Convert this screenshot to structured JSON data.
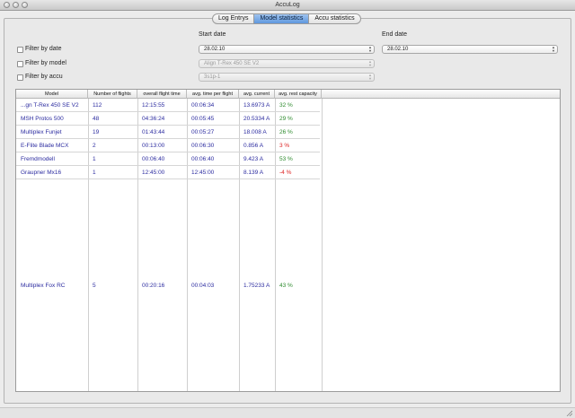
{
  "window": {
    "title": "AccuLog"
  },
  "tabs": [
    {
      "label": "Log Entrys"
    },
    {
      "label": "Model statistics"
    },
    {
      "label": "Accu statistics"
    }
  ],
  "filters": {
    "start_date_label": "Start date",
    "end_date_label": "End date",
    "by_date_label": "Filter by date",
    "by_model_label": "Filter by model",
    "by_accu_label": "Filter by accu",
    "start_date_value": "28.02.10",
    "end_date_value": "28.02.10",
    "model_value": "Align T-Rex 450 SE V2",
    "accu_value": "3s1p-1"
  },
  "table": {
    "columns": [
      "Model",
      "Number of flights",
      "overall flight time",
      "avg. time per flight",
      "avg. current",
      "avg. rest capacity"
    ],
    "rows": [
      [
        "...gn T-Rex 450 SE V2",
        "112",
        "12:15:55",
        "00:06:34",
        "13.6973 A",
        "32 %"
      ],
      [
        "MSH Protos 500",
        "48",
        "04:36:24",
        "00:05:45",
        "20.5334 A",
        "29 %"
      ],
      [
        "Multiplex Funjet",
        "19",
        "01:43:44",
        "00:05:27",
        "18.008 A",
        "26 %"
      ],
      [
        "E-Flite Blade MCX",
        "2",
        "00:13:00",
        "00:06:30",
        "0.856 A",
        "3 %"
      ],
      [
        "Fremdmodell",
        "1",
        "00:06:40",
        "00:06:40",
        "9.423 A",
        "53 %"
      ],
      [
        "Graupner Mx16",
        "1",
        "12:45:00",
        "12:45:00",
        "8.139 A",
        "-4 %"
      ],
      [
        "Multiplex Fox RC",
        "5",
        "00:20:16",
        "00:04:03",
        "1.75233 A",
        "43 %"
      ]
    ]
  },
  "colors": {
    "link_text": "#2c2ca0",
    "positive_capacity": "#2e8b2e",
    "negative_capacity": "#dd2222",
    "active_tab": "#6fa3e3"
  },
  "icons": {
    "dropdown": "updown-arrows-icon",
    "resize": "resize-grip-icon"
  }
}
